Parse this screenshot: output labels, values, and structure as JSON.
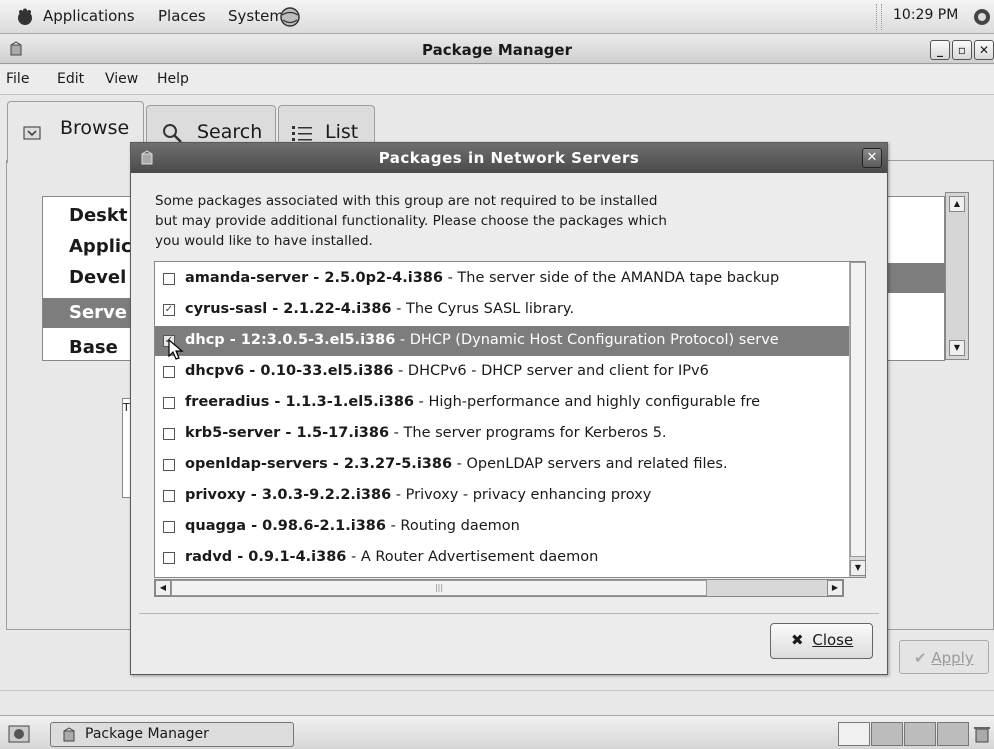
{
  "top_panel": {
    "applications": "Applications",
    "places": "Places",
    "system": "System",
    "clock": "10:29 PM"
  },
  "window": {
    "title": "Package Manager",
    "menus": [
      "File",
      "Edit",
      "View",
      "Help"
    ],
    "tabs": [
      "Browse",
      "Search",
      "List"
    ],
    "groups": [
      "Deskt",
      "Applic",
      "Devel",
      "Serve",
      "Base"
    ],
    "selected_group_index": 3,
    "desc_letter": "T",
    "apply_label": "Apply"
  },
  "dialog": {
    "title": "Packages in Network Servers",
    "message": "Some packages associated with this group are not required to be installed but may provide additional functionality.  Please choose the packages which you would like to have installed.",
    "close_label": "Close",
    "packages": [
      {
        "name": "amanda-server - 2.5.0p2-4.i386",
        "desc": " - The server side of the AMANDA tape backup",
        "checked": false,
        "selected": false
      },
      {
        "name": "cyrus-sasl - 2.1.22-4.i386",
        "desc": " - The Cyrus SASL library.",
        "checked": true,
        "selected": false
      },
      {
        "name": "dhcp - 12:3.0.5-3.el5.i386",
        "desc": " - DHCP (Dynamic Host Configuration Protocol) serve",
        "checked": true,
        "selected": true
      },
      {
        "name": "dhcpv6 - 0.10-33.el5.i386",
        "desc": " - DHCPv6 - DHCP server and client for IPv6",
        "checked": false,
        "selected": false
      },
      {
        "name": "freeradius - 1.1.3-1.el5.i386",
        "desc": " - High-performance and highly configurable fre",
        "checked": false,
        "selected": false
      },
      {
        "name": "krb5-server - 1.5-17.i386",
        "desc": " - The server programs for Kerberos 5.",
        "checked": false,
        "selected": false
      },
      {
        "name": "openldap-servers - 2.3.27-5.i386",
        "desc": " - OpenLDAP servers and related files.",
        "checked": false,
        "selected": false
      },
      {
        "name": "privoxy - 3.0.3-9.2.2.i386",
        "desc": " - Privoxy - privacy enhancing proxy",
        "checked": false,
        "selected": false
      },
      {
        "name": "quagga - 0.98.6-2.1.i386",
        "desc": " - Routing daemon",
        "checked": false,
        "selected": false
      },
      {
        "name": "radvd - 0.9.1-4.i386",
        "desc": " - A Router Advertisement daemon",
        "checked": false,
        "selected": false
      }
    ]
  },
  "taskbar": {
    "task_label": "Package Manager"
  }
}
